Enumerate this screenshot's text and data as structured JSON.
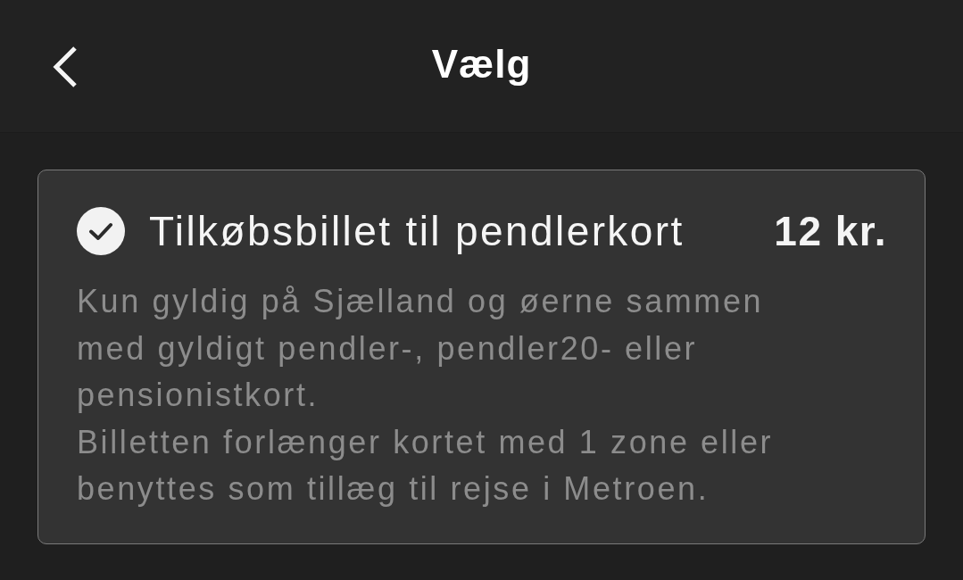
{
  "header": {
    "title": "Vælg"
  },
  "options": [
    {
      "title": "Tilkøbsbillet til pendlerkort",
      "price": "12 kr.",
      "selected": true,
      "description": [
        "Kun gyldig på Sjælland og øerne sammen med gyldigt pendler-, pendler20- eller pensionistkort.",
        "Billetten forlænger kortet med 1 zone eller benyttes som tillæg til rejse i Metroen."
      ]
    }
  ]
}
